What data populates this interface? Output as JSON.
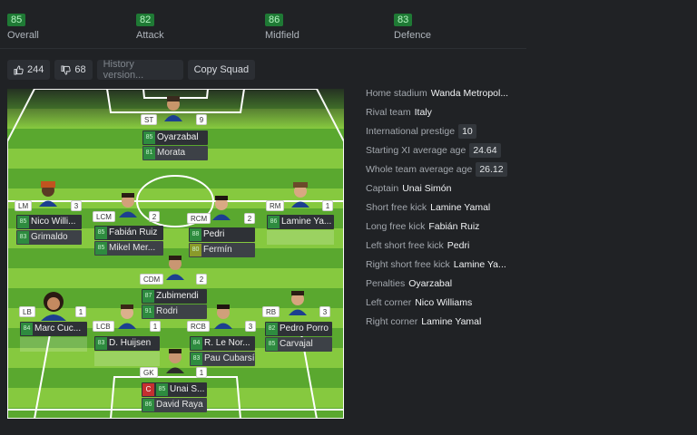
{
  "ratings": [
    {
      "value": "85",
      "label": "Overall"
    },
    {
      "value": "82",
      "label": "Attack"
    },
    {
      "value": "86",
      "label": "Midfield"
    },
    {
      "value": "83",
      "label": "Defence"
    }
  ],
  "toolbar": {
    "likes": "244",
    "dislikes": "68",
    "history_placeholder": "History version...",
    "copy_label": "Copy Squad"
  },
  "players": [
    {
      "pos": "ST",
      "num": "9",
      "name": "Oyarzabal",
      "rating": "85",
      "sub": "Morata",
      "sub_rating": "81"
    },
    {
      "pos": "LM",
      "num": "3",
      "name": "Nico Willi...",
      "rating": "85",
      "sub": "Grimaldo",
      "sub_rating": "83"
    },
    {
      "pos": "LCM",
      "num": "2",
      "name": "Fabián Ruiz",
      "rating": "85",
      "sub": "Mikel Mer...",
      "sub_rating": "85"
    },
    {
      "pos": "RCM",
      "num": "2",
      "name": "Pedri",
      "rating": "88",
      "sub": "Fermín",
      "sub_rating": "80"
    },
    {
      "pos": "RM",
      "num": "1",
      "name": "Lamine Ya...",
      "rating": "86",
      "sub": "",
      "sub_rating": ""
    },
    {
      "pos": "CDM",
      "num": "2",
      "name": "Zubimendi",
      "rating": "87",
      "sub": "Rodri",
      "sub_rating": "91"
    },
    {
      "pos": "LB",
      "num": "1",
      "name": "Marc Cuc...",
      "rating": "84",
      "sub": "",
      "sub_rating": ""
    },
    {
      "pos": "LCB",
      "num": "1",
      "name": "D. Huijsen",
      "rating": "83",
      "sub": "",
      "sub_rating": ""
    },
    {
      "pos": "RCB",
      "num": "3",
      "name": "R. Le Nor...",
      "rating": "84",
      "sub": "Pau Cubarsí",
      "sub_rating": "83"
    },
    {
      "pos": "RB",
      "num": "3",
      "name": "Pedro Porro",
      "rating": "82",
      "sub": "Carvajal",
      "sub_rating": "85"
    },
    {
      "pos": "GK",
      "num": "1",
      "name": "Unai S...",
      "rating": "85",
      "sub": "David Raya",
      "sub_rating": "86",
      "captain": "C"
    }
  ],
  "info": {
    "stadium_label": "Home stadium",
    "stadium": "Wanda Metropol...",
    "rival_label": "Rival team",
    "rival": "Italy",
    "prestige_label": "International prestige",
    "prestige": "10",
    "xi_age_label": "Starting XI average age",
    "xi_age": "24.64",
    "team_age_label": "Whole team average age",
    "team_age": "26.12",
    "captain_label": "Captain",
    "captain": "Unai Simón",
    "sfk_label": "Short free kick",
    "sfk": "Lamine Yamal",
    "lfk_label": "Long free kick",
    "lfk": "Fabián Ruiz",
    "lsfk_label": "Left short free kick",
    "lsfk": "Pedri",
    "rsfk_label": "Right short free kick",
    "rsfk": "Lamine Ya...",
    "pen_label": "Penalties",
    "pen": "Oyarzabal",
    "lc_label": "Left corner",
    "lc": "Nico Williams",
    "rc_label": "Right corner",
    "rc": "Lamine Yamal"
  },
  "colors": {
    "accent": "#1f7a35",
    "pitch_dark": "#5aa82f",
    "pitch_light": "#86c93f",
    "captain": "#c53030"
  }
}
